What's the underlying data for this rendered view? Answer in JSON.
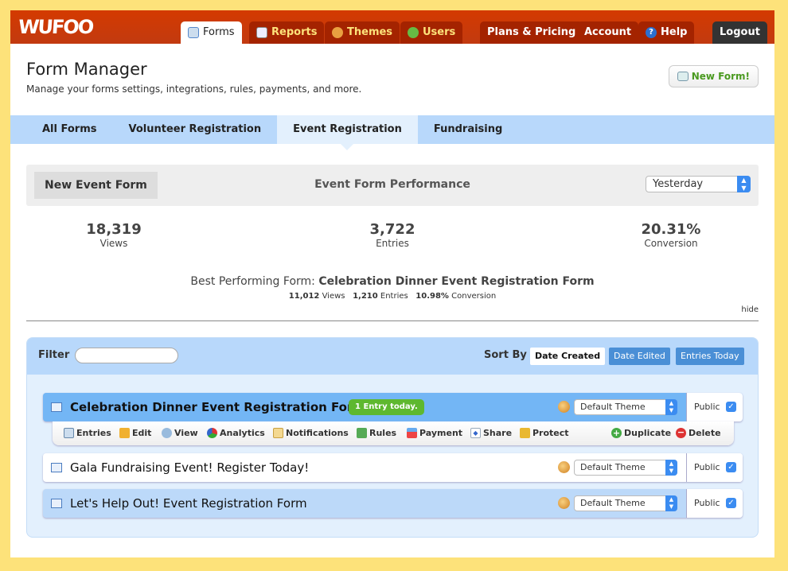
{
  "header": {
    "logo": "WUFOO",
    "nav": [
      {
        "label": "Forms",
        "icon": "form-icon"
      },
      {
        "label": "Reports",
        "icon": "report-icon"
      },
      {
        "label": "Themes",
        "icon": "palette-icon"
      },
      {
        "label": "Users",
        "icon": "users-icon"
      },
      {
        "label": "Plans & Pricing"
      },
      {
        "label": "Account"
      },
      {
        "label": "Help",
        "icon": "help-icon"
      },
      {
        "label": "Logout"
      }
    ]
  },
  "page": {
    "title": "Form Manager",
    "subtitle": "Manage your forms settings, integrations, rules, payments, and more.",
    "new_form": "New Form!"
  },
  "tabs": [
    "All Forms",
    "Volunteer Registration",
    "Event Registration",
    "Fundraising"
  ],
  "performance": {
    "new_button": "New Event Form",
    "title": "Event Form Performance",
    "period": "Yesterday",
    "stats": [
      {
        "value": "18,319",
        "label": "Views"
      },
      {
        "value": "3,722",
        "label": "Entries"
      },
      {
        "value": "20.31%",
        "label": "Conversion"
      }
    ],
    "best_label": "Best Performing Form:",
    "best_name": "Celebration Dinner Event Registration Form",
    "best_views": "11,012",
    "best_views_label": "Views",
    "best_entries": "1,210",
    "best_entries_label": "Entries",
    "best_conversion": "10.98%",
    "best_conversion_label": "Conversion",
    "hide": "hide"
  },
  "filter": {
    "label": "Filter",
    "value": "",
    "sort_label": "Sort By :",
    "sort": [
      "Date Created",
      "Date Edited",
      "Entries Today"
    ]
  },
  "forms": [
    {
      "name": "Celebration Dinner Event Registration Form",
      "badge": "1 Entry today.",
      "theme": "Default Theme",
      "public": "Public"
    },
    {
      "name": "Gala Fundraising Event! Register Today!",
      "theme": "Default Theme",
      "public": "Public"
    },
    {
      "name": "Let's Help Out! Event Registration Form",
      "theme": "Default Theme",
      "public": "Public"
    }
  ],
  "actions": [
    "Entries",
    "Edit",
    "View",
    "Analytics",
    "Notifications",
    "Rules",
    "Payment",
    "Share",
    "Protect",
    "Duplicate",
    "Delete"
  ],
  "colors": {
    "header": "#c9380a",
    "tab_bar": "#b8d8fb",
    "accent": "#3b8cf1",
    "badge": "#5eb82f"
  }
}
